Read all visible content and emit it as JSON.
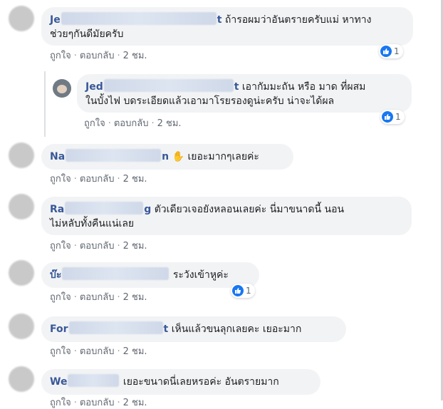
{
  "comments": [
    {
      "name_start": "Je",
      "name_end": "t",
      "text_line1": "ถ้ารอผมว่าอันตรายครับแม่ หาทาง",
      "text_line2": "ช่วยๆกันดีมัยครับ",
      "like_label": "ถูกใจ",
      "reply_label": "ตอบกลับ",
      "time": "2 ชม.",
      "reaction_count": "1"
    },
    {
      "name_start": "Jed",
      "name_end": "t",
      "text_line1": "เอากัมมะถัน หรือ มาด ที่ผสม",
      "text_line2": "ในบั้งไฟ บดระเอียดแล้วเอามาโรยรองดูน่ะครับ น่าจะได้ผล",
      "like_label": "ถูกใจ",
      "reply_label": "ตอบกลับ",
      "time": "2 ชม.",
      "reaction_count": "1"
    },
    {
      "name_start": "Na",
      "name_end": "n",
      "text_line1": "เยอะมากๆเลยค่ะ",
      "like_label": "ถูกใจ",
      "reply_label": "ตอบกลับ",
      "time": "2 ชม."
    },
    {
      "name_start": "Ra",
      "name_end": "g",
      "text_line1": "ตัวเดียวเจอยังหลอนเลยค่ะ นี่มาขนาดนี้ นอน",
      "text_line2": "ไม่หลับทั้งคืนแน่เลย",
      "like_label": "ถูกใจ",
      "reply_label": "ตอบกลับ",
      "time": "2 ชม."
    },
    {
      "name_start": "บ๊ะ",
      "name_end": "",
      "text_line1": "ระวังเข้าหูค่ะ",
      "like_label": "ถูกใจ",
      "reply_label": "ตอบกลับ",
      "time": "2 ชม.",
      "reaction_count": "1"
    },
    {
      "name_start": "For",
      "name_end": "t",
      "text_line1": "เห็นแล้วขนลุกเลยคะ เยอะมาก",
      "like_label": "ถูกใจ",
      "reply_label": "ตอบกลับ",
      "time": "2 ชม."
    },
    {
      "name_start": "We",
      "name_end": "",
      "text_line1": "เยอะขนาดนี่เลยหรอค่ะ อันตรายมาก",
      "like_label": "ถูกใจ",
      "reply_label": "ตอบกลับ",
      "time": "2 ชม."
    }
  ],
  "colors": {
    "name": "#385898",
    "bubble": "#f2f3f5",
    "like_blue": "#1877f2",
    "meta": "#616770"
  },
  "icons": {
    "reaction": "like-thumb-icon",
    "emoji": "raised-hand-icon"
  }
}
